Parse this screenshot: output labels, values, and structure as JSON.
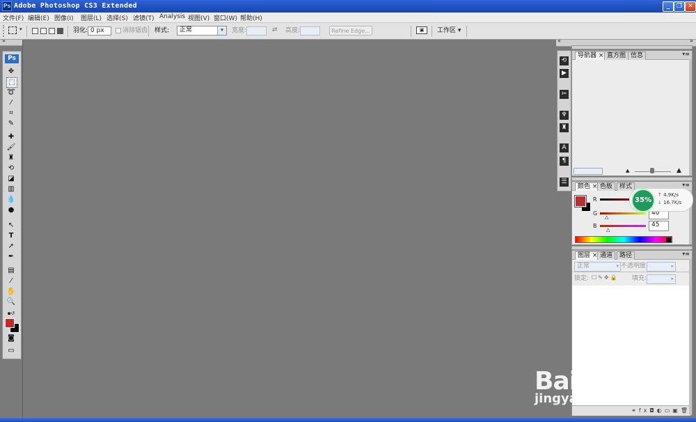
{
  "app": {
    "title": "Adobe Photoshop CS3 Extended",
    "icon": "Ps"
  },
  "window_controls": {
    "minimize": "_",
    "restore": "❐",
    "close": "✕"
  },
  "menu": [
    "文件(F)",
    "编辑(E)",
    "图像(I)",
    "图层(L)",
    "选择(S)",
    "滤镜(T)",
    "Analysis",
    "视图(V)",
    "窗口(W)",
    "帮助(H)"
  ],
  "options_bar": {
    "feather_label": "羽化:",
    "feather_value": "0 px",
    "antialias_label": "消除锯齿",
    "style_label": "样式:",
    "style_value": "正常",
    "width_label": "宽度:",
    "height_label": "高度:",
    "refine_edge": "Refine Edge...",
    "workspace": "工作区 ▾"
  },
  "tools_panel": {
    "badge": "Ps"
  },
  "navigator_panel": {
    "tabs": [
      "导航器",
      "直方图",
      "信息"
    ],
    "menu_icon": "▾≡"
  },
  "color_panel": {
    "tabs": [
      "颜色",
      "色板",
      "样式"
    ],
    "foreground_color": "#c02b2b",
    "background_color": "#000000",
    "channels": [
      {
        "label": "R",
        "value": ""
      },
      {
        "label": "G",
        "value": "40"
      },
      {
        "label": "B",
        "value": "45"
      }
    ]
  },
  "layers_panel": {
    "tabs": [
      "图层",
      "通道",
      "路径"
    ],
    "blend_mode": "正常",
    "opacity_label": "不透明度:",
    "lock_label": "锁定:",
    "fill_label": "填充:"
  },
  "network_badge": {
    "percent": "35%",
    "upload": "4.9K/s",
    "download": "16.7K/s"
  },
  "watermark": {
    "logo": "Bai du 经验",
    "url": "jingyan.baidu.com"
  }
}
